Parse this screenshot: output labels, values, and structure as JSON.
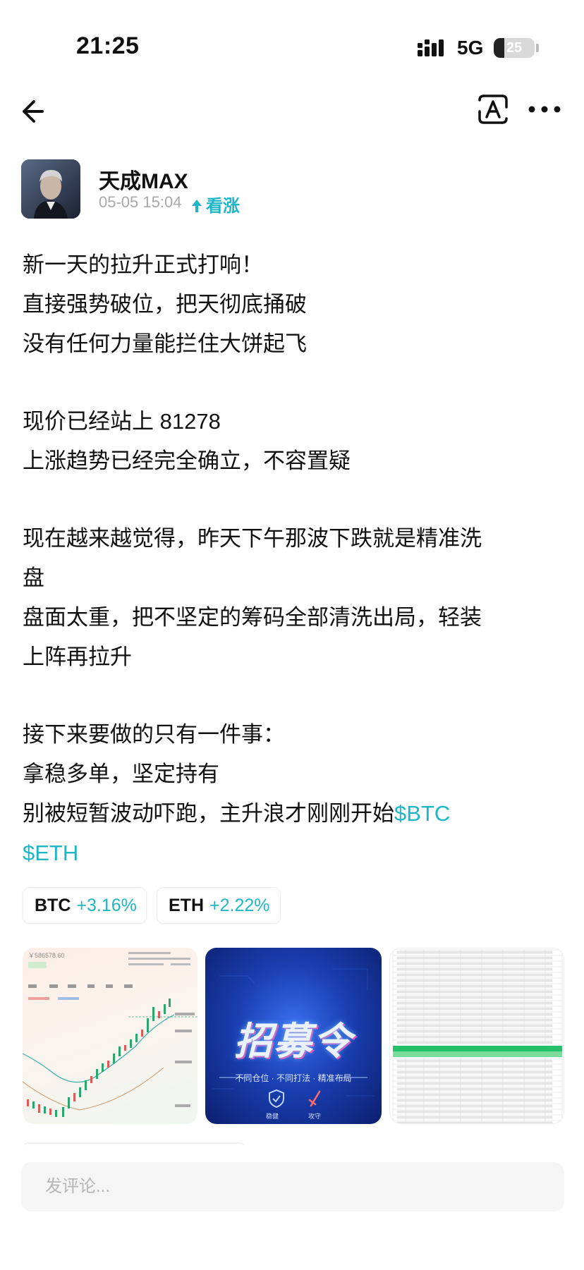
{
  "status_bar": {
    "time": "21:25",
    "network": "5G",
    "battery": "25",
    "battery_level": 0.25
  },
  "nav": {
    "back_icon": "arrow-left-icon",
    "translate_icon": "translate-icon",
    "more_icon": "more-dots-icon"
  },
  "author": {
    "name": "天成MAX",
    "datetime": "05-05 15:04",
    "sentiment": "看涨",
    "sentiment_color": "#1fb5c6"
  },
  "post": {
    "lines": [
      "新一天的拉升正式打响！",
      "直接强势破位，把天彻底捅破",
      "没有任何力量能拦住大饼起飞",
      "",
      "现价已经站上 81278",
      "上涨趋势已经完全确立，不容置疑",
      "",
      "现在越来越觉得，昨天下午那波下跌就是精准洗",
      "盘",
      "盘面太重，把不坚定的筹码全部清洗出局，轻装",
      "上阵再拉升",
      "",
      "接下来要做的只有一件事：",
      "拿稳多单，坚定持有",
      "别被短暂波动吓跑，主升浪才刚刚开始"
    ],
    "ticker_btc": "$BTC",
    "ticker_eth": "$ETH"
  },
  "chips": [
    {
      "symbol": "BTC",
      "change": "+3.16%"
    },
    {
      "symbol": "ETH",
      "change": "+2.22%"
    }
  ],
  "thumbnails": {
    "chart_price": "￥586578.60",
    "recruit_title": "招募令",
    "recruit_subtitle": "不同仓位 · 不同打法 · 精准布局",
    "recruit_left_label": "稳健",
    "recruit_right_label": "攻守"
  },
  "comment": {
    "placeholder": "发评论..."
  }
}
